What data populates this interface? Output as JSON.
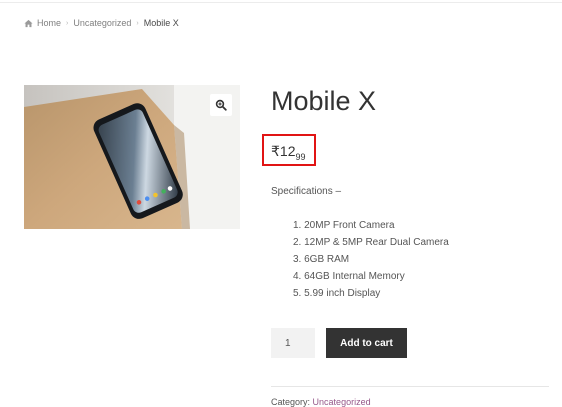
{
  "breadcrumb": {
    "home_icon": "home-icon",
    "items": [
      "Home",
      "Uncategorized",
      "Mobile X"
    ],
    "separator": "›"
  },
  "gallery": {
    "zoom_icon": "zoom-in-icon",
    "image_subject": "smartphone on wooden table"
  },
  "product": {
    "title": "Mobile X",
    "price_currency": "₹",
    "price_whole": "12",
    "price_cents": "99",
    "spec_heading": "Specifications –",
    "specs": [
      "1. 20MP Front Camera",
      "2. 12MP & 5MP Rear Dual Camera",
      "3. 6GB RAM",
      "4. 64GB Internal Memory",
      "5. 5.99 inch Display"
    ],
    "quantity": "1",
    "add_to_cart_label": "Add to cart",
    "category_label": "Category:",
    "category_value": "Uncategorized"
  },
  "colors": {
    "highlight_border": "#e11414",
    "button_bg": "#333333",
    "link": "#96588a"
  }
}
